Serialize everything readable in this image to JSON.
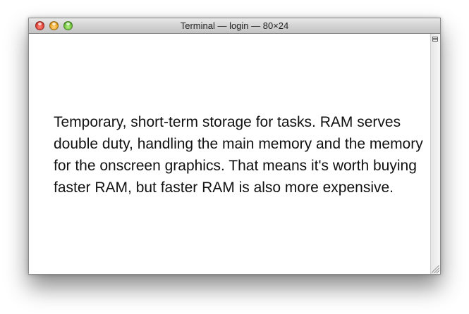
{
  "window": {
    "title": "Terminal — login — 80×24"
  },
  "controls": {
    "close_icon": "close-icon",
    "minimize_icon": "minimize-icon",
    "zoom_icon": "zoom-icon"
  },
  "content": {
    "text": "Temporary, short-term storage for tasks. RAM serves double duty, handling the main memory and the memory for the onscreen graphics. That means it's worth buying faster RAM, but faster RAM is also more expensive."
  }
}
